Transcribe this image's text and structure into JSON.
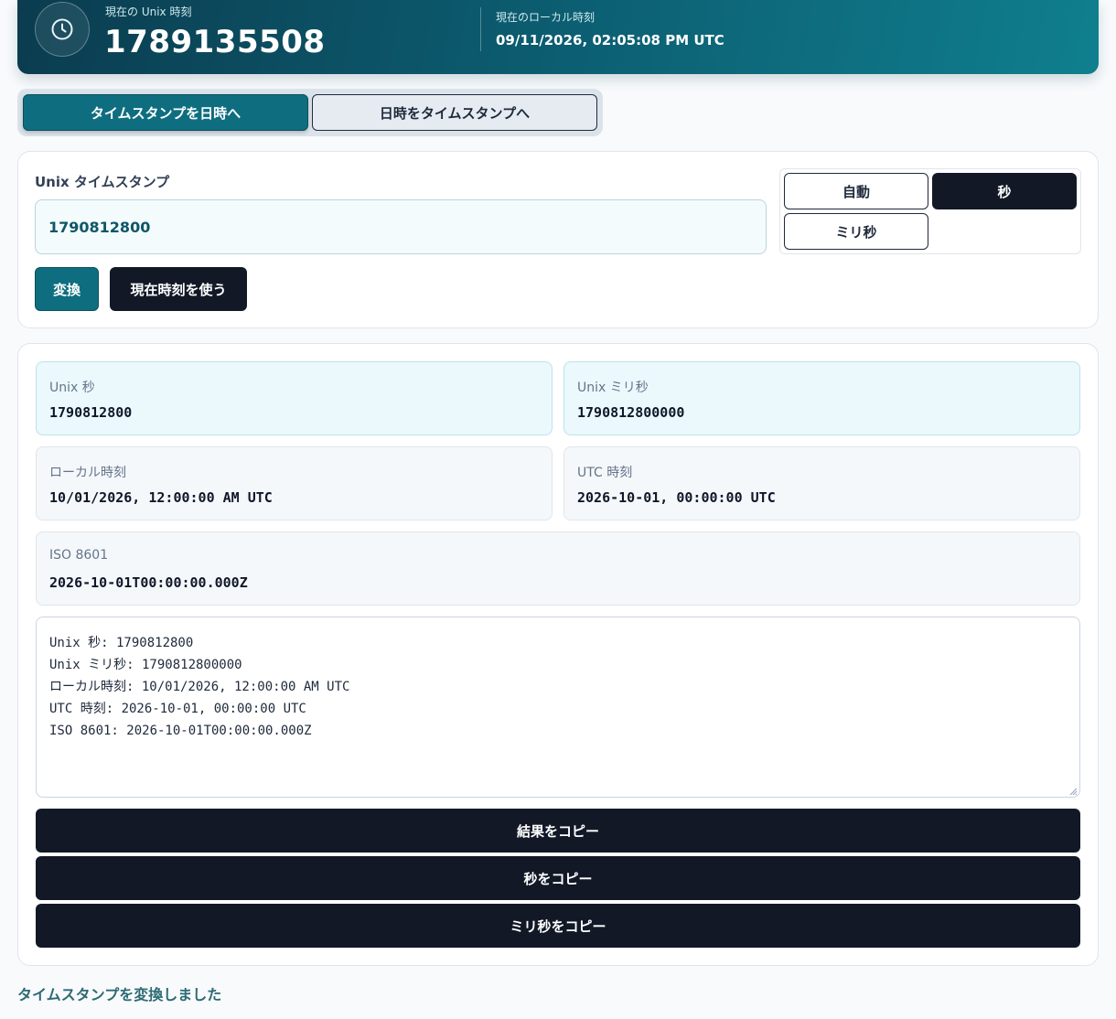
{
  "header": {
    "unix_label": "現在の Unix 時刻",
    "unix_value": "1789135508",
    "local_label": "現在のローカル時刻",
    "local_value": "09/11/2026, 02:05:08 PM UTC",
    "icon": "clock-icon"
  },
  "tabs": {
    "active": "タイムスタンプを日時へ",
    "inactive": "日時をタイムスタンプへ"
  },
  "input": {
    "label": "Unix タイムスタンプ",
    "value": "1790812800",
    "units": {
      "auto": "自動",
      "seconds": "秒",
      "milliseconds": "ミリ秒",
      "selected": "秒"
    },
    "convert_label": "変換",
    "now_label": "現在時刻を使う"
  },
  "results": {
    "unix_sec": {
      "label": "Unix 秒",
      "value": "1790812800"
    },
    "unix_ms": {
      "label": "Unix ミリ秒",
      "value": "1790812800000"
    },
    "local": {
      "label": "ローカル時刻",
      "value": "10/01/2026, 12:00:00 AM UTC"
    },
    "utc": {
      "label": "UTC 時刻",
      "value": "2026-10-01, 00:00:00 UTC"
    },
    "iso": {
      "label": "ISO 8601",
      "value": "2026-10-01T00:00:00.000Z"
    },
    "summary": "Unix 秒: 1790812800\nUnix ミリ秒: 1790812800000\nローカル時刻: 10/01/2026, 12:00:00 AM UTC\nUTC 時刻: 2026-10-01, 00:00:00 UTC\nISO 8601: 2026-10-01T00:00:00.000Z",
    "copy_result": "結果をコピー",
    "copy_seconds": "秒をコピー",
    "copy_ms": "ミリ秒をコピー"
  },
  "status": "タイムスタンプを変換しました",
  "colors": {
    "accent": "#0e6e80",
    "dark": "#121826",
    "status": "#2d6a74"
  }
}
